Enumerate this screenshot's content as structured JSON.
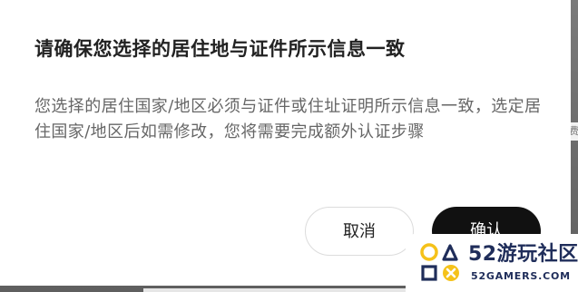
{
  "dialog": {
    "title": "请确保您选择的居住地与证件所示信息一致",
    "body": "您选择的居住国家/地区必须与证件或住址证明所示信息一致，选定居住国家/地区后如需修改，您将需要完成额外认证步骤",
    "cancel_label": "取消",
    "confirm_label": "确认"
  },
  "background": {
    "edge_glyph": "费"
  },
  "watermark": {
    "logo_icon": "playstation-shapes-logo",
    "site_name": "52游玩社区",
    "domain": "52GAMERS.COM"
  },
  "colors": {
    "confirm_button": "#111111",
    "dialog_background": "#ffffff",
    "watermark_text": "#1f2d5a",
    "logo_yellow": "#f5c21a"
  }
}
